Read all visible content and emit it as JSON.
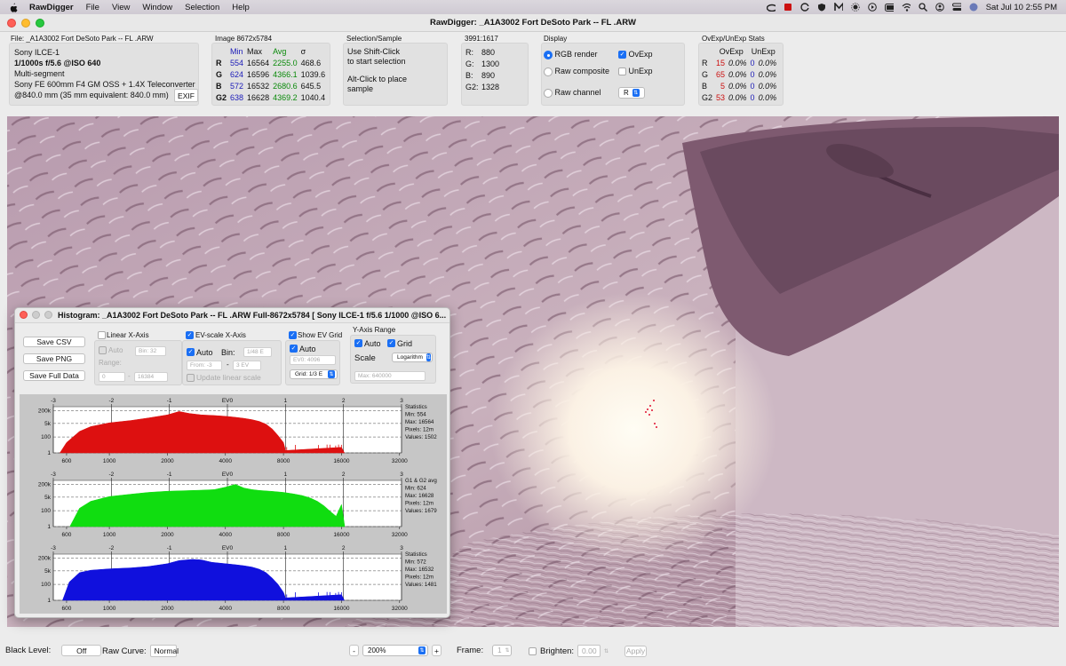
{
  "menubar": {
    "app": "RawDigger",
    "items": [
      "File",
      "View",
      "Window",
      "Selection",
      "Help"
    ],
    "clock": "Sat Jul 10  2:55 PM"
  },
  "window": {
    "title": "RawDigger: _A1A3002 Fort DeSoto Park -- FL .ARW"
  },
  "file_panel": {
    "label": "File: _A1A3002 Fort DeSoto Park -- FL .ARW",
    "lines": [
      "Sony ILCE-1",
      "1/1000s f/5.6 @ISO 640",
      "Multi-segment",
      "Sony FE 600mm F4 GM OSS + 1.4X Teleconverter",
      "@840.0 mm (35 mm equivalent: 840.0 mm)"
    ],
    "exif_button": "EXIF"
  },
  "image_panel": {
    "label": "Image 8672x5784",
    "headers": [
      "",
      "Min",
      "Max",
      "Avg",
      "σ"
    ],
    "rows": [
      [
        "R",
        "554",
        "16564",
        "2255.0",
        "468.6"
      ],
      [
        "G",
        "624",
        "16596",
        "4366.1",
        "1039.6"
      ],
      [
        "B",
        "572",
        "16532",
        "2680.6",
        "645.5"
      ],
      [
        "G2",
        "638",
        "16628",
        "4369.2",
        "1040.4"
      ]
    ]
  },
  "selection_panel": {
    "label": "Selection/Sample",
    "text1": "Use Shift-Click",
    "text2": "to start selection",
    "text3": "Alt-Click to place",
    "text4": "sample"
  },
  "coord_panel": {
    "label": "3991:1617",
    "rows": [
      [
        "R:",
        "880"
      ],
      [
        "G:",
        "1300"
      ],
      [
        "B:",
        "890"
      ],
      [
        "G2:",
        "1328"
      ]
    ]
  },
  "display_panel": {
    "label": "Display",
    "rgb_render": "RGB render",
    "raw_composite": "Raw composite",
    "raw_channel": "Raw channel",
    "ovexp": "OvExp",
    "unexp": "UnExp",
    "channel_value": "R"
  },
  "ovexp_panel": {
    "label": "OvExp/UnExp Stats",
    "headers": [
      "",
      "OvExp",
      "",
      "UnExp",
      ""
    ],
    "rows": [
      [
        "R",
        "15",
        "0.0%",
        "0",
        "0.0%"
      ],
      [
        "G",
        "65",
        "0.0%",
        "0",
        "0.0%"
      ],
      [
        "B",
        "5",
        "0.0%",
        "0",
        "0.0%"
      ],
      [
        "G2",
        "53",
        "0.0%",
        "0",
        "0.0%"
      ]
    ]
  },
  "histogram": {
    "title": "Histogram: _A1A3002 Fort DeSoto Park -- FL .ARW Full-8672x5784 [ Sony ILCE-1 f/5.6 1/1000 @ISO 6...",
    "buttons": [
      "Save CSV",
      "Save PNG",
      "Save Full Data"
    ],
    "linear": {
      "label": "Linear X-Axis",
      "auto": "Auto",
      "bin": "Bin: 32",
      "range": "Range:",
      "from": "0",
      "to": "16384"
    },
    "evscale": {
      "label": "EV-scale X-Axis",
      "auto": "Auto",
      "bin_label": "Bin:",
      "bin_value": "1/48 E",
      "from": "From: -3",
      "to": "3 EV",
      "update": "Update linear scale"
    },
    "evgrid": {
      "label": "Show EV Grid",
      "auto": "Auto",
      "ev0": "EV0: 4096",
      "grid": "Grid: 1/3 E"
    },
    "yaxis": {
      "label": "Y-Axis Range",
      "auto": "Auto",
      "grid": "Grid",
      "scale": "Scale",
      "scale_value": "Logarithm",
      "max": "Max: 640000"
    }
  },
  "chart_data": [
    {
      "type": "area",
      "channel": "R",
      "color": "#dd1010",
      "x_ticks": [
        "600",
        "1000",
        "2000",
        "4000",
        "8000",
        "16000",
        "32000"
      ],
      "ev_ticks": [
        "-3",
        "-2",
        "-1",
        "EV0",
        "1",
        "2",
        "3"
      ],
      "y_ticks": [
        "200k",
        "5k",
        "100",
        "1"
      ],
      "x": [
        554,
        600,
        700,
        800,
        1000,
        1300,
        1600,
        2000,
        2300,
        2600,
        3000,
        3500,
        4000,
        4500,
        5000,
        5500,
        6000,
        6500,
        7000,
        7500,
        8000,
        8200,
        16000,
        16564
      ],
      "y": [
        1,
        20,
        500,
        2000,
        6000,
        12000,
        25000,
        60000,
        160000,
        90000,
        60000,
        50000,
        40000,
        30000,
        22000,
        15000,
        9000,
        4000,
        1000,
        150,
        20,
        2,
        5,
        1
      ],
      "stats": [
        "Statistics",
        "Min: 554",
        "Max: 16564",
        "Pixels: 12m",
        "Values: 1502"
      ]
    },
    {
      "type": "area",
      "channel": "G",
      "color": "#10dd10",
      "x_ticks": [
        "600",
        "1000",
        "2000",
        "4000",
        "8000",
        "16000",
        "32000"
      ],
      "ev_ticks": [
        "-3",
        "-2",
        "-1",
        "EV0",
        "1",
        "2",
        "3"
      ],
      "y_ticks": [
        "200k",
        "5k",
        "100",
        "1"
      ],
      "x": [
        624,
        700,
        800,
        1000,
        1300,
        1600,
        2000,
        2500,
        3000,
        3500,
        4000,
        4500,
        5000,
        5500,
        6000,
        7000,
        8000,
        9000,
        10000,
        11000,
        12000,
        13000,
        14000,
        15000,
        16000,
        16628
      ],
      "y": [
        1,
        200,
        1500,
        6000,
        12000,
        20000,
        28000,
        33000,
        38000,
        45000,
        90000,
        200000,
        70000,
        45000,
        35000,
        27000,
        20000,
        13000,
        8000,
        4000,
        1500,
        400,
        80,
        20,
        600,
        1
      ],
      "stats": [
        "G1 & G2 avg",
        "Min: 624",
        "Max: 16628",
        "Pixels: 12m",
        "Values: 1679"
      ]
    },
    {
      "type": "area",
      "channel": "B",
      "color": "#1010dd",
      "x_ticks": [
        "600",
        "1000",
        "2000",
        "4000",
        "8000",
        "16000",
        "32000"
      ],
      "ev_ticks": [
        "-3",
        "-2",
        "-1",
        "EV0",
        "1",
        "2",
        "3"
      ],
      "y_ticks": [
        "200k",
        "5k",
        "100",
        "1"
      ],
      "x": [
        572,
        620,
        700,
        800,
        1000,
        1300,
        1600,
        2000,
        2300,
        2700,
        3000,
        3400,
        4000,
        4500,
        5000,
        5500,
        6000,
        6500,
        7000,
        7500,
        8000,
        8200,
        16000,
        16532
      ],
      "y": [
        1,
        200,
        3000,
        6000,
        9000,
        12000,
        18000,
        40000,
        100000,
        140000,
        120000,
        60000,
        40000,
        30000,
        22000,
        15000,
        8000,
        3000,
        600,
        100,
        10,
        2,
        5,
        1
      ],
      "stats": [
        "Statistics",
        "Min: 572",
        "Max: 16532",
        "Pixels: 12m",
        "Values: 1481"
      ]
    }
  ],
  "statusbar": {
    "black_level_label": "Black Level:",
    "black_level_value": "Off",
    "raw_curve_label": "Raw Curve:",
    "raw_curve_value": "Normal",
    "zoom_minus": "-",
    "zoom_value": "200%",
    "zoom_plus": "+",
    "frame_label": "Frame:",
    "frame_value": "1",
    "brighten_label": "Brighten:",
    "brighten_value": "0.00",
    "apply": "Apply"
  }
}
